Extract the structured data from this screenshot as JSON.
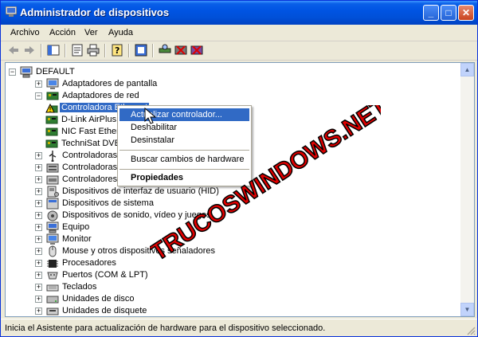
{
  "window": {
    "title": "Administrador de dispositivos"
  },
  "titlebar": {
    "min_glyph": "_",
    "max_glyph": "□",
    "close_glyph": "✕"
  },
  "menu": [
    "Archivo",
    "Acción",
    "Ver",
    "Ayuda"
  ],
  "toolbar_icons": [
    "back-icon",
    "forward-icon",
    "console-tree-icon",
    "properties-icon",
    "print-icon",
    "help-icon",
    "update-driver-icon",
    "scan-hardware-icon",
    "uninstall-icon",
    "disable-icon"
  ],
  "tree": [
    {
      "label": "DEFAULT",
      "level": 0,
      "expander": "−",
      "icon": "computer-icon"
    },
    {
      "label": "Adaptadores de pantalla",
      "level": 1,
      "expander": "+",
      "icon": "monitor-icon"
    },
    {
      "label": "Adaptadores de red",
      "level": 1,
      "expander": "−",
      "icon": "network-card-icon"
    },
    {
      "label": "Controladora Ethernet",
      "level": 2,
      "expander": "",
      "icon": "warning-device-icon",
      "selected": true
    },
    {
      "label": "D-Link AirPlus",
      "level": 2,
      "expander": "",
      "icon": "network-card-icon"
    },
    {
      "label": "NIC Fast Ether",
      "level": 2,
      "expander": "",
      "icon": "network-card-icon"
    },
    {
      "label": "TechniSat DVB",
      "level": 2,
      "expander": "",
      "icon": "network-card-icon"
    },
    {
      "label": "Controladoras de b",
      "level": 1,
      "expander": "+",
      "icon": "usb-icon"
    },
    {
      "label": "Controladoras IDE",
      "level": 1,
      "expander": "+",
      "icon": "ide-icon"
    },
    {
      "label": "Controladores de d",
      "level": 1,
      "expander": "+",
      "icon": "disk-controller-icon"
    },
    {
      "label": "Dispositivos de interfaz de usuario (HID)",
      "level": 1,
      "expander": "+",
      "icon": "hid-icon"
    },
    {
      "label": "Dispositivos de sistema",
      "level": 1,
      "expander": "+",
      "icon": "system-icon"
    },
    {
      "label": "Dispositivos de sonido, vídeo y juegos",
      "level": 1,
      "expander": "+",
      "icon": "sound-icon"
    },
    {
      "label": "Equipo",
      "level": 1,
      "expander": "+",
      "icon": "computer-icon"
    },
    {
      "label": "Monitor",
      "level": 1,
      "expander": "+",
      "icon": "monitor-icon"
    },
    {
      "label": "Mouse y otros dispositivos señaladores",
      "level": 1,
      "expander": "+",
      "icon": "mouse-icon"
    },
    {
      "label": "Procesadores",
      "level": 1,
      "expander": "+",
      "icon": "processor-icon"
    },
    {
      "label": "Puertos (COM & LPT)",
      "level": 1,
      "expander": "+",
      "icon": "port-icon"
    },
    {
      "label": "Teclados",
      "level": 1,
      "expander": "+",
      "icon": "keyboard-icon"
    },
    {
      "label": "Unidades de disco",
      "level": 1,
      "expander": "+",
      "icon": "disk-drive-icon"
    },
    {
      "label": "Unidades de disquete",
      "level": 1,
      "expander": "+",
      "icon": "floppy-icon"
    }
  ],
  "context_menu": {
    "items": [
      {
        "label": "Actualizar controlador...",
        "highlighted": true
      },
      {
        "label": "Deshabilitar"
      },
      {
        "label": "Desinstalar"
      },
      {
        "label": "Buscar cambios de hardware"
      },
      {
        "label": "Propiedades",
        "bold": true
      }
    ]
  },
  "watermark": "TRUCOSWINDOWS.NET",
  "status": {
    "text": "Inicia el Asistente para actualización de hardware para el dispositivo seleccionado."
  },
  "colors": {
    "titlebar": "#0054e3",
    "selection": "#316ac5",
    "watermark_red": "#e00000",
    "window_bg": "#ece9d8"
  }
}
